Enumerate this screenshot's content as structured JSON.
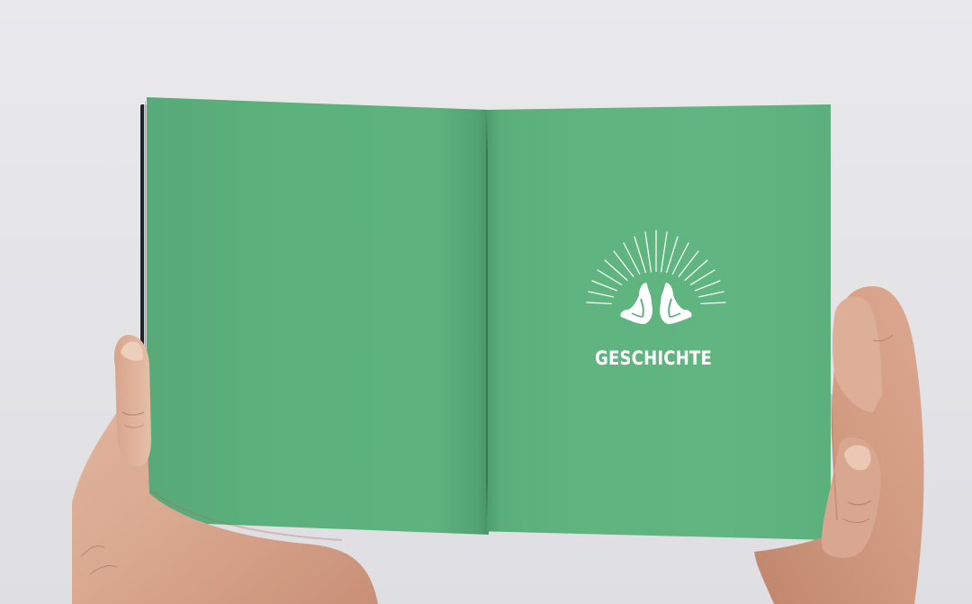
{
  "image": {
    "description_kind": "photo",
    "background_color": "#e6e6e9",
    "page_color": "#5db27d",
    "text_color": "#ffffff"
  },
  "booklet": {
    "right_page": {
      "emblem_icon": "sunburst-with-raised-arms-icon",
      "title": "GESCHICHTE"
    }
  }
}
